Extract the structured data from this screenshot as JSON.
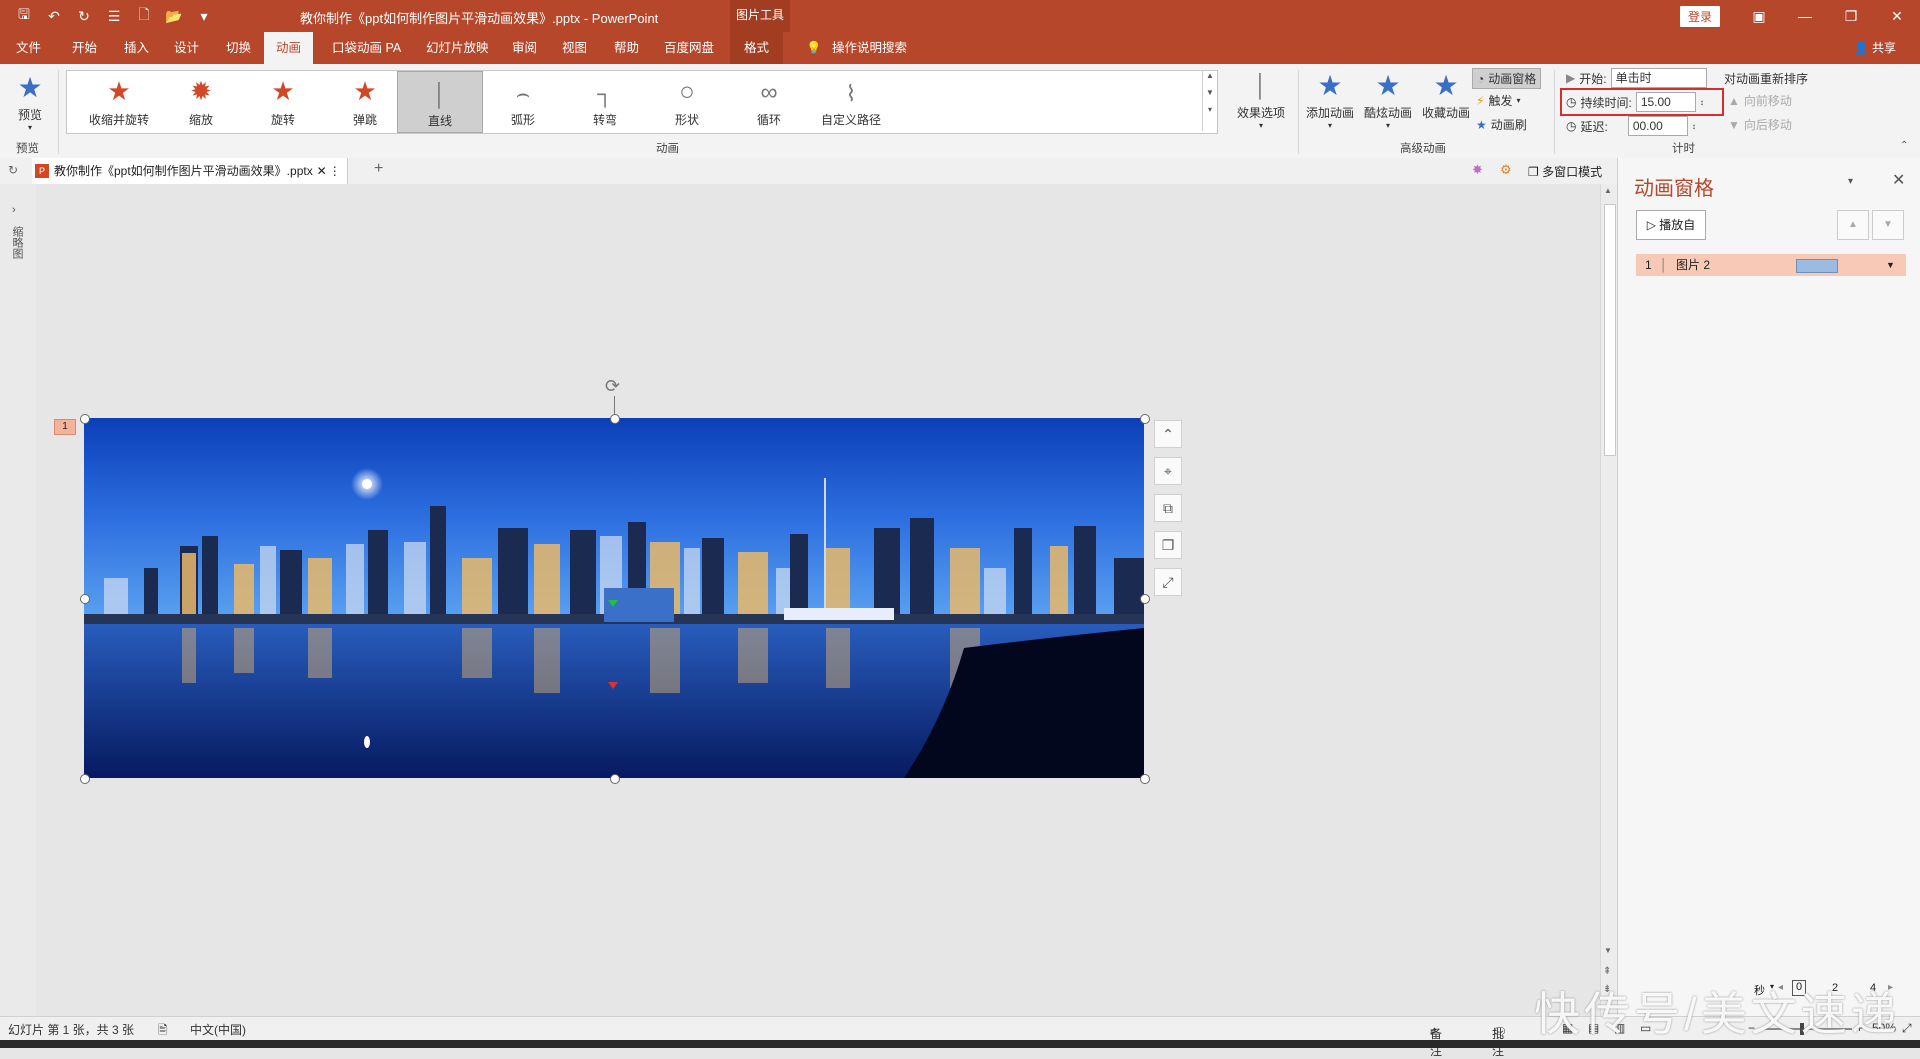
{
  "titlebar": {
    "title": "教你制作《ppt如何制作图片平滑动画效果》.pptx  -  PowerPoint",
    "context_tools": "图片工具",
    "login": "登录"
  },
  "menu": {
    "tabs": [
      "文件",
      "开始",
      "插入",
      "设计",
      "切换",
      "动画",
      "口袋动画 PA",
      "幻灯片放映",
      "审阅",
      "视图",
      "帮助",
      "百度网盘"
    ],
    "active_tab": "动画",
    "context_tab": "格式",
    "tell_me": "操作说明搜索",
    "share": "共享"
  },
  "ribbon": {
    "preview": {
      "label": "预览",
      "group": "预览"
    },
    "gallery": {
      "group": "动画",
      "items": [
        {
          "label": "收缩并旋转",
          "icon": "star-spin-icon"
        },
        {
          "label": "缩放",
          "icon": "star-zoom-icon"
        },
        {
          "label": "旋转",
          "icon": "star-rotate-icon"
        },
        {
          "label": "弹跳",
          "icon": "star-bounce-icon"
        },
        {
          "label": "直线",
          "icon": "line-path-icon"
        },
        {
          "label": "弧形",
          "icon": "arc-path-icon"
        },
        {
          "label": "转弯",
          "icon": "turn-path-icon"
        },
        {
          "label": "形状",
          "icon": "shape-path-icon"
        },
        {
          "label": "循环",
          "icon": "loop-path-icon"
        },
        {
          "label": "自定义路径",
          "icon": "custom-path-icon"
        }
      ],
      "selected": "直线"
    },
    "effect_options": "效果选项",
    "advanced": {
      "group": "高级动画",
      "add_animation": "添加动画",
      "cool_animation": "酷炫动画",
      "fav_animation": "收藏动画",
      "animation_pane": "动画窗格",
      "trigger": "触发",
      "painter": "动画刷"
    },
    "timing": {
      "group": "计时",
      "start_label": "开始:",
      "start_value": "单击时",
      "duration_label": "持续时间:",
      "duration_value": "15.00",
      "delay_label": "延迟:",
      "delay_value": "00.00",
      "reorder": "对动画重新排序",
      "move_earlier": "向前移动",
      "move_later": "向后移动"
    }
  },
  "doc_tab": {
    "name": "教你制作《ppt如何制作图片平滑动画效果》.pptx",
    "multiwindow": "多窗口模式"
  },
  "left_rail": {
    "label": "缩略图"
  },
  "slide": {
    "animation_badge": "1"
  },
  "animation_pane": {
    "title": "动画窗格",
    "play_from": "播放自",
    "item": {
      "index": "1",
      "name": "图片 2"
    },
    "timeline": {
      "unit": "秒",
      "ticks": [
        "0",
        "2",
        "4"
      ]
    }
  },
  "status": {
    "slide_info": "幻灯片 第 1 张，共 3 张",
    "language": "中文(中国)",
    "notes": "备注",
    "comments": "批注",
    "zoom": "50%"
  },
  "watermark": "快传号/美文速递",
  "colors": {
    "accent": "#b7472a",
    "selection": "#f7c9b6",
    "highlight": "#d03030"
  }
}
